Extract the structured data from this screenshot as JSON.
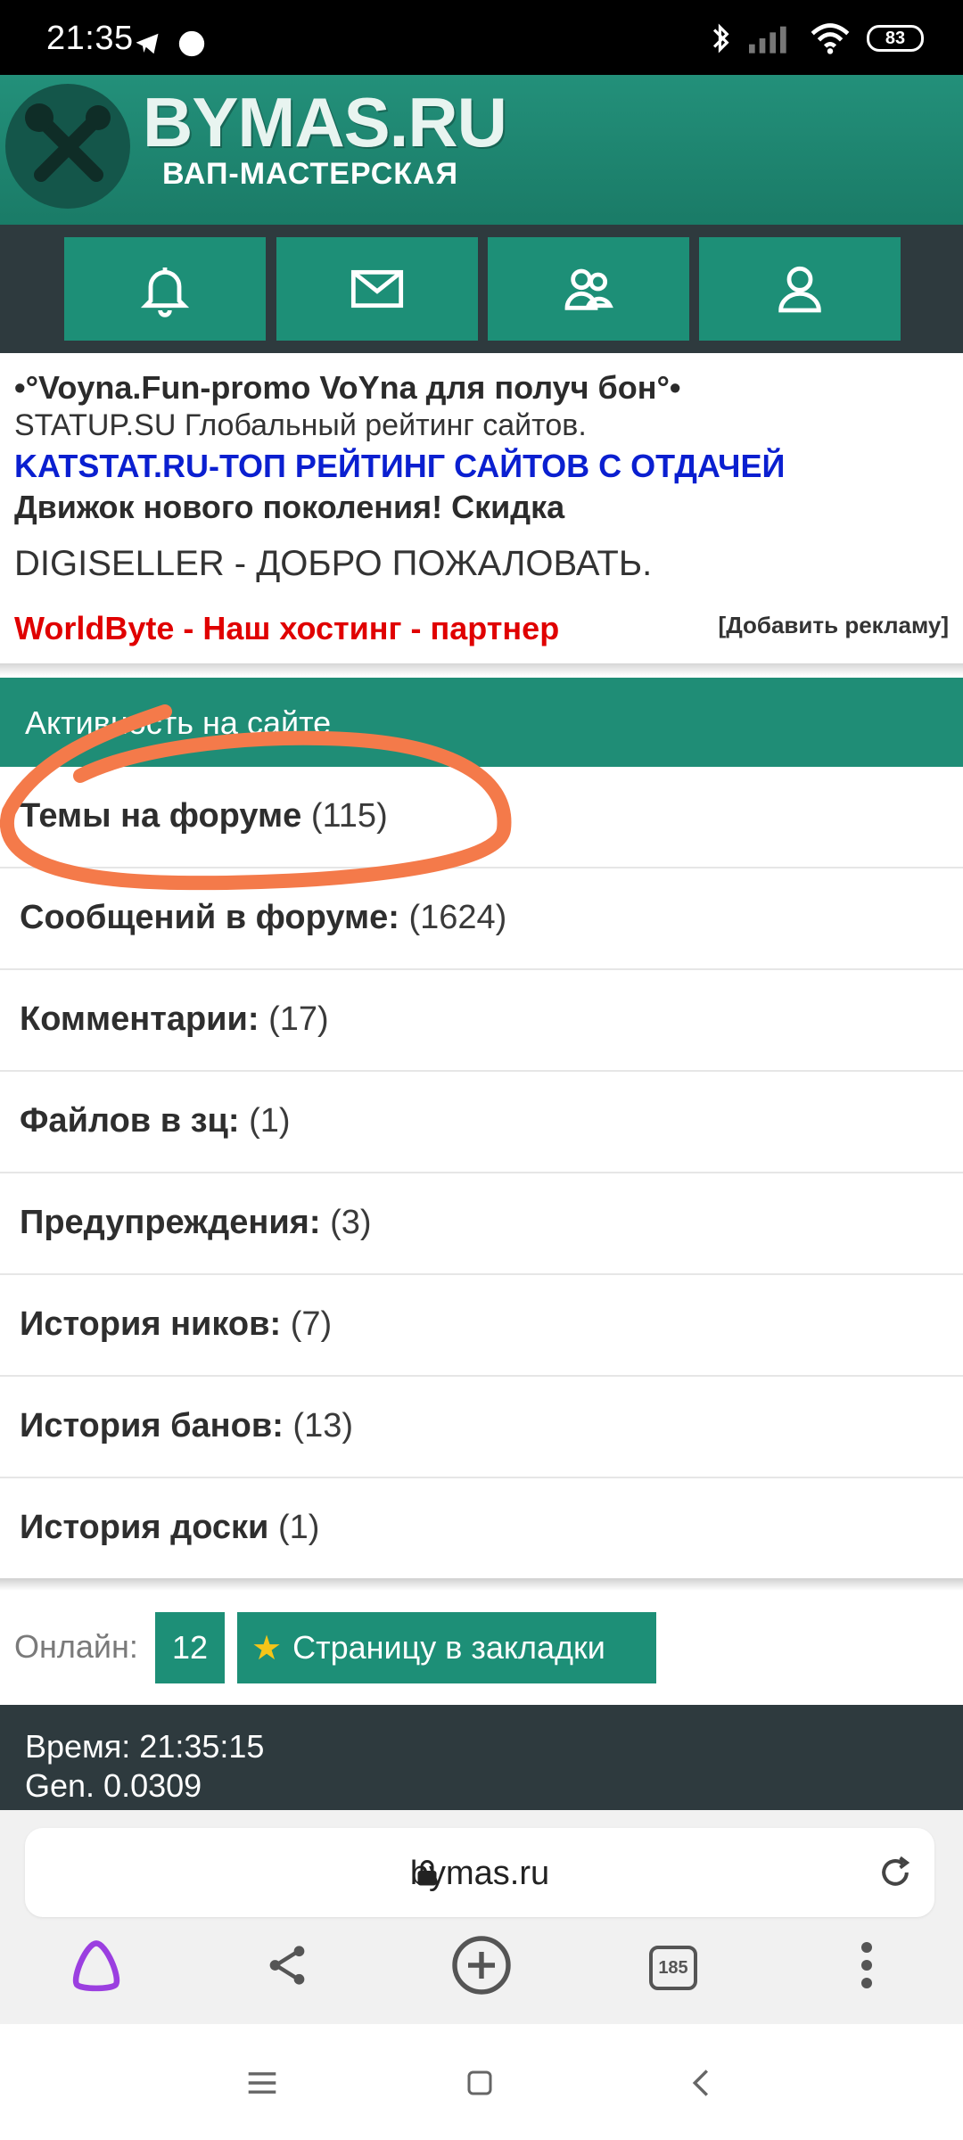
{
  "status_bar": {
    "time": "21:35",
    "battery": "83"
  },
  "header": {
    "title": "BYMAS.RU",
    "subtitle": "ВАП-МАСТЕРСКАЯ"
  },
  "nav": {
    "items": [
      {
        "icon": "bell-icon"
      },
      {
        "icon": "mail-icon"
      },
      {
        "icon": "users-icon"
      },
      {
        "icon": "user-icon"
      }
    ]
  },
  "ads": {
    "items": [
      "•°Voyna.Fun-promo VoYna для получ бон°•",
      "STATUP.SU Глобальный рейтинг сайтов.",
      "KATSTAT.RU-ТОП РЕЙТИНГ САЙТОВ С ОТДАЧЕЙ",
      "Движок нового поколения! Скидка",
      "DIGISELLER - ДОБРО ПОЖАЛОВАТЬ.",
      "WorldByte - Наш хостинг - партнер"
    ],
    "add_label": "[Добавить рекламу]"
  },
  "activity": {
    "title": "Активность на сайте",
    "rows": [
      {
        "label": "Темы на форуме",
        "count": "(115)"
      },
      {
        "label": "Сообщений в форуме:",
        "count": "(1624)"
      },
      {
        "label": "Комментарии:",
        "count": "(17)"
      },
      {
        "label": "Файлов в зц:",
        "count": "(1)"
      },
      {
        "label": "Предупреждения:",
        "count": "(3)"
      },
      {
        "label": "История ников:",
        "count": "(7)"
      },
      {
        "label": "История банов:",
        "count": "(13)"
      },
      {
        "label": "История доски",
        "count": "(1)"
      }
    ]
  },
  "online": {
    "label": "Онлайн:",
    "count": "12",
    "bookmark_label": "Страницу в закладки",
    "bookmark_icon": "star-icon"
  },
  "footer": {
    "time_line": "Время: 21:35:15",
    "gen_line": "Gen. 0.0309"
  },
  "browser": {
    "url": "bymas.ru",
    "tabs_count": "185"
  },
  "colors": {
    "brand_green": "#1d8f77",
    "dark": "#2e3a3e",
    "annotation_orange": "#f47a4a"
  }
}
